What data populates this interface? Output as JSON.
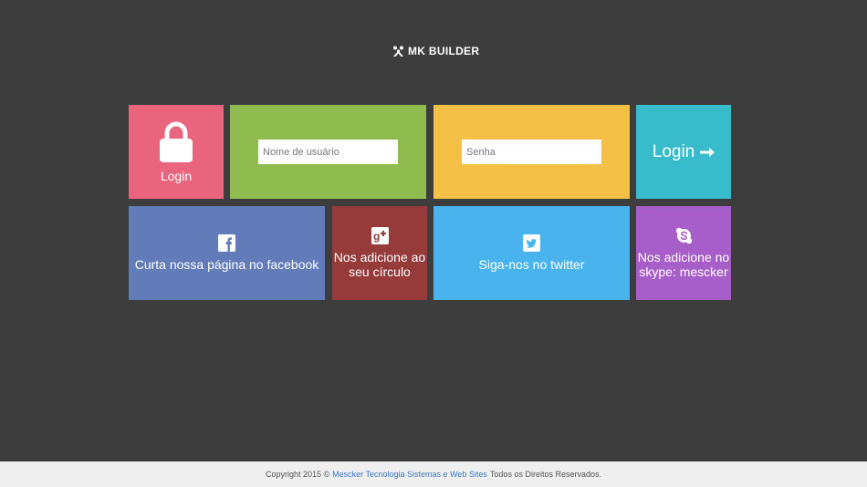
{
  "logo": {
    "text": "MK BUILDER",
    "icon": "mk-logo-icon"
  },
  "tiles": {
    "lock": {
      "label": "Login",
      "color": "#e8657d",
      "icon": "lock-icon"
    },
    "username": {
      "placeholder": "Nome de usuário",
      "value": "",
      "color": "#8fbc4e"
    },
    "password": {
      "placeholder": "Senha",
      "value": "",
      "color": "#f4c046"
    },
    "login_button": {
      "label": "Login",
      "color": "#38bccb",
      "icon": "arrow-right-icon"
    },
    "facebook": {
      "label": "Curta nossa página no facebook",
      "color": "#617cb8",
      "icon": "facebook-icon"
    },
    "googleplus": {
      "line1": "Nos adicione ao",
      "line2": "seu círculo",
      "color": "#963a3a",
      "icon": "google-plus-icon"
    },
    "twitter": {
      "label": "Siga-nos no twitter",
      "color": "#49b3ee",
      "icon": "twitter-icon"
    },
    "skype": {
      "line1": "Nos adicione no",
      "line2": "skype: mescker",
      "color": "#a85ec8",
      "icon": "skype-icon"
    }
  },
  "footer": {
    "prefix": "Copyright 2015 ©",
    "link": "Mescker Tecnologia Sistemas e Web Sites",
    "suffix": "Todos os Direitos Reservados."
  }
}
